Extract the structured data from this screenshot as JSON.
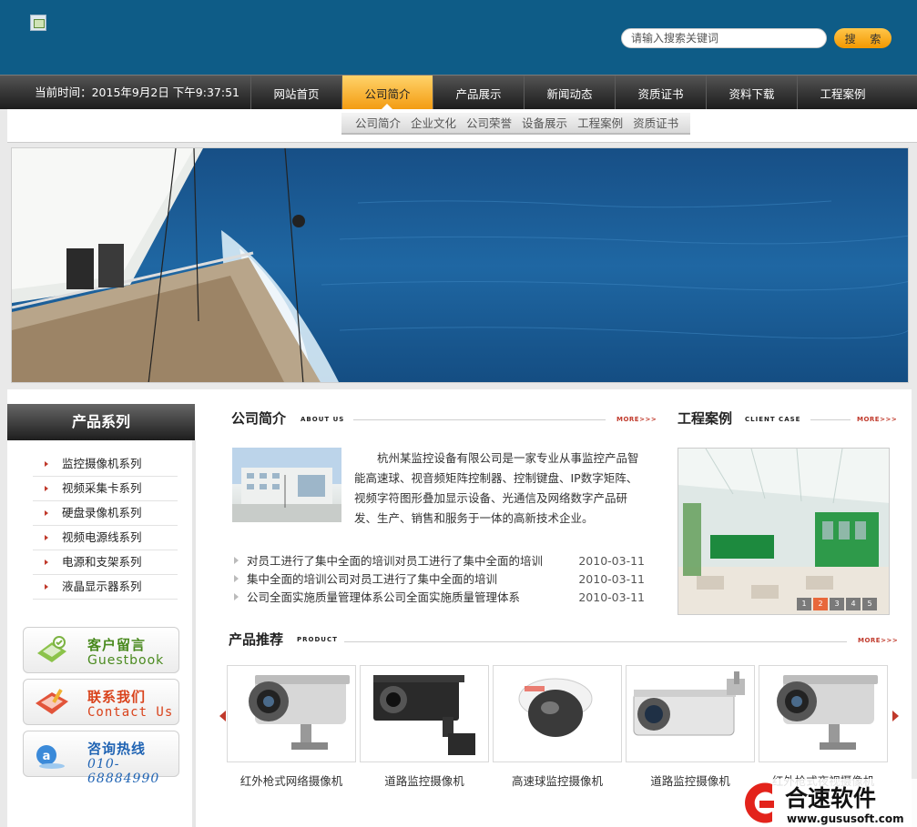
{
  "header": {
    "search_placeholder": "请输入搜索关键词",
    "search_button": "搜 索"
  },
  "nav": {
    "datetime": "当前时间：2015年9月2日 下午9:37:51",
    "items": [
      "网站首页",
      "公司简介",
      "产品展示",
      "新闻动态",
      "资质证书",
      "资料下载",
      "工程案例"
    ],
    "active": "公司简介"
  },
  "subnav": {
    "items": [
      "公司简介",
      "企业文化",
      "公司荣誉",
      "设备展示",
      "工程案例",
      "资质证书"
    ]
  },
  "sidebar": {
    "title": "产品系列",
    "items": [
      "监控摄像机系列",
      "视频采集卡系列",
      "硬盘录像机系列",
      "视频电源线系列",
      "电源和支架系列",
      "液晶显示器系列"
    ],
    "contacts": [
      {
        "title": "客户留言",
        "subtitle": "Guestbook",
        "color": "#4a8a1f",
        "icon": "guestbook-icon"
      },
      {
        "title": "联系我们",
        "subtitle": "Contact Us",
        "color": "#d9431c",
        "icon": "contact-icon"
      },
      {
        "title": "咨询热线",
        "subtitle": "010-68884990",
        "color": "#1f63b3",
        "icon": "hotline-icon"
      }
    ]
  },
  "about": {
    "title": "公司简介",
    "en": "ABOUT US",
    "more": "MORE>>>",
    "text": "杭州某监控设备有限公司是一家专业从事监控产品智能高速球、视音频矩阵控制器、控制键盘、IP数字矩阵、视频字符图形叠加显示设备、光通信及网络数字产品研发、生产、销售和服务于一体的高新技术企业。"
  },
  "news": [
    {
      "title": "对员工进行了集中全面的培训对员工进行了集中全面的培训",
      "date": "2010-03-11"
    },
    {
      "title": "集中全面的培训公司对员工进行了集中全面的培训",
      "date": "2010-03-11"
    },
    {
      "title": "公司全面实施质量管理体系公司全面实施质量管理体系",
      "date": "2010-03-11"
    }
  ],
  "cases": {
    "title": "工程案例",
    "en": "CLIENT CASE",
    "more": "MORE>>>",
    "pager": [
      "1",
      "2",
      "3",
      "4",
      "5"
    ],
    "active_page": "2"
  },
  "products": {
    "title": "产品推荐",
    "en": "PRODUCT",
    "more": "MORE>>>",
    "items": [
      "红外枪式网络摄像机",
      "道路监控摄像机",
      "高速球监控摄像机",
      "道路监控摄像机",
      "红外枪式夜视摄像机"
    ]
  },
  "watermark": {
    "name": "合速软件",
    "url": "www.gususoft.com"
  },
  "colors": {
    "header_bg": "#0e5c87",
    "accent_orange": "#f39800",
    "accent_red": "#c0392b"
  }
}
